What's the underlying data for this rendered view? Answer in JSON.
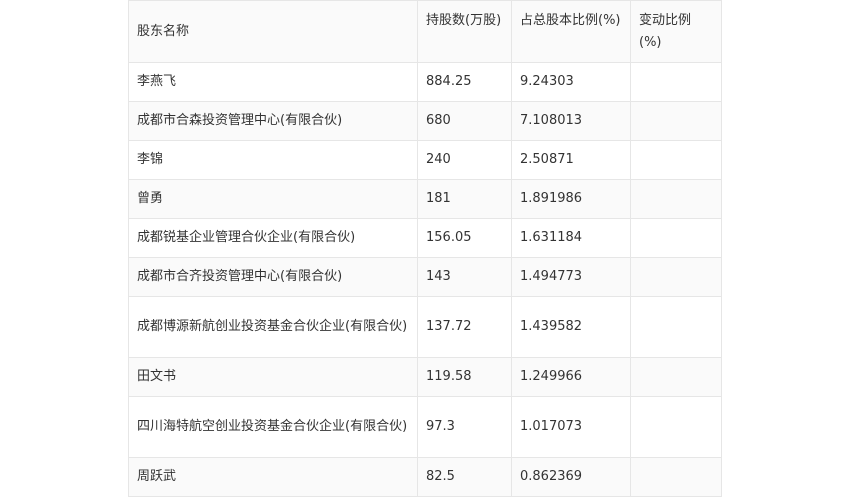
{
  "table": {
    "headers": {
      "name": "股东名称",
      "shares": "持股数(万股)",
      "ratio": "占总股本比例(%)",
      "change": "变动比例(%)"
    },
    "rows": [
      {
        "name": "李燕飞",
        "shares": "884.25",
        "ratio": "9.24303",
        "change": ""
      },
      {
        "name": "成都市合森投资管理中心(有限合伙)",
        "shares": "680",
        "ratio": "7.108013",
        "change": ""
      },
      {
        "name": "李锦",
        "shares": "240",
        "ratio": "2.50871",
        "change": ""
      },
      {
        "name": "曾勇",
        "shares": "181",
        "ratio": "1.891986",
        "change": ""
      },
      {
        "name": "成都锐基企业管理合伙企业(有限合伙)",
        "shares": "156.05",
        "ratio": "1.631184",
        "change": ""
      },
      {
        "name": "成都市合齐投资管理中心(有限合伙)",
        "shares": "143",
        "ratio": "1.494773",
        "change": ""
      },
      {
        "name": "成都博源新航创业投资基金合伙企业(有限合伙)",
        "shares": "137.72",
        "ratio": "1.439582",
        "change": ""
      },
      {
        "name": "田文书",
        "shares": "119.58",
        "ratio": "1.249966",
        "change": ""
      },
      {
        "name": "四川海特航空创业投资基金合伙企业(有限合伙)",
        "shares": "97.3",
        "ratio": "1.017073",
        "change": ""
      },
      {
        "name": "周跃武",
        "shares": "82.5",
        "ratio": "0.862369",
        "change": ""
      }
    ]
  }
}
